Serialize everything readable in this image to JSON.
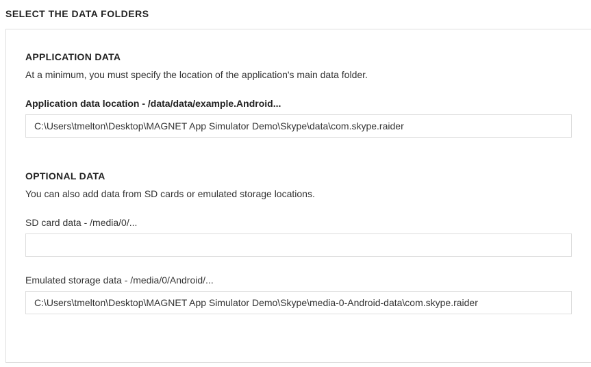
{
  "page": {
    "title": "SELECT THE DATA FOLDERS"
  },
  "applicationData": {
    "heading": "APPLICATION DATA",
    "description": "At a minimum, you must specify the location of the application's main data folder.",
    "locationField": {
      "label": "Application data location - /data/data/example.Android...",
      "value": "C:\\Users\\tmelton\\Desktop\\MAGNET App Simulator Demo\\Skype\\data\\com.skype.raider"
    }
  },
  "optionalData": {
    "heading": "OPTIONAL DATA",
    "description": "You can also add data from SD cards or emulated storage locations.",
    "sdCardField": {
      "label": "SD card data - /media/0/...",
      "value": ""
    },
    "emulatedStorageField": {
      "label": "Emulated storage data - /media/0/Android/...",
      "value": "C:\\Users\\tmelton\\Desktop\\MAGNET App Simulator Demo\\Skype\\media-0-Android-data\\com.skype.raider"
    }
  }
}
